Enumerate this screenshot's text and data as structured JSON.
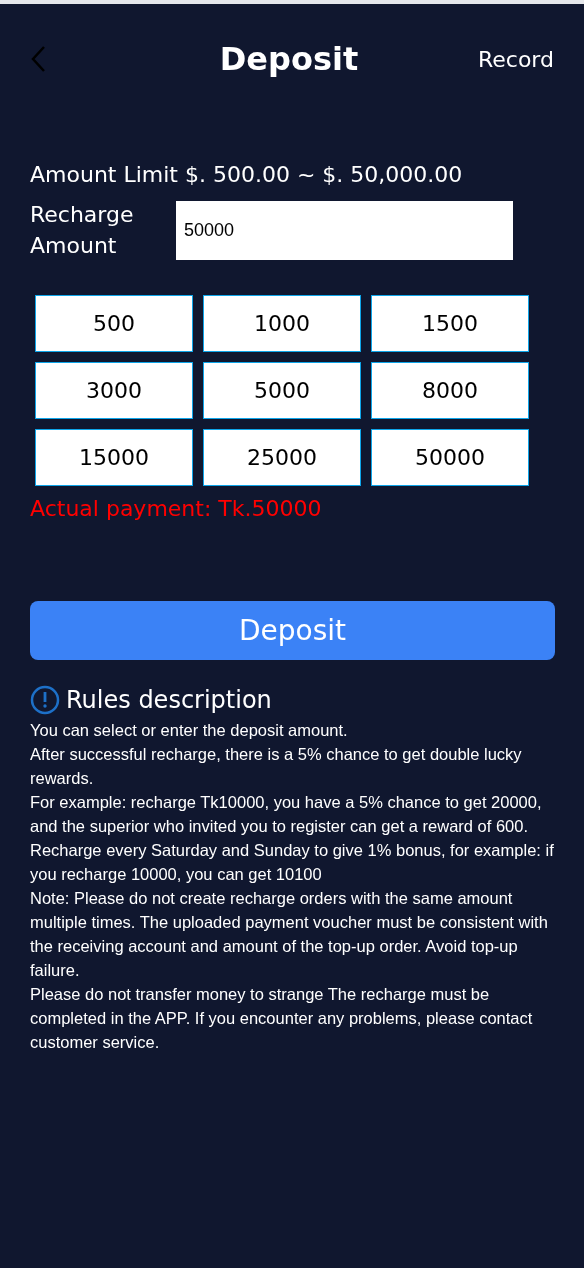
{
  "header": {
    "title": "Deposit",
    "record_link": "Record"
  },
  "amount_limit": "Amount Limit $. 500.00 ~ $. 50,000.00",
  "recharge_field": {
    "label": "Recharge Amount",
    "value": "50000"
  },
  "amount_options": [
    "500",
    "1000",
    "1500",
    "3000",
    "5000",
    "8000",
    "15000",
    "25000",
    "50000"
  ],
  "actual_payment": "Actual payment: Tk.50000",
  "deposit_button": "Deposit",
  "rules": {
    "title": "Rules description",
    "lines": [
      "You can select or enter the deposit amount.",
      "After successful recharge, there is a 5% chance to get double lucky rewards.",
      "For example: recharge Tk10000, you have a 5% chance to get 20000, and the superior who invited you to register can get a reward of 600.",
      "Recharge every Saturday and Sunday to give 1% bonus, for example: if you recharge 10000, you can get 10100",
      "Note: Please do not create recharge orders with the same amount multiple times. The uploaded payment voucher must be consistent with the receiving account and amount of the top-up order. Avoid top-up failure.",
      "Please do not transfer money to strange The recharge must be completed in the APP. If you encounter any problems, please contact customer service."
    ]
  }
}
